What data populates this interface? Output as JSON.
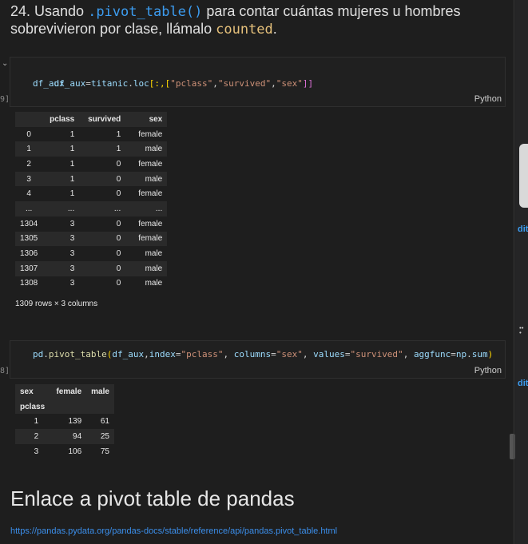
{
  "heading": {
    "part1": "24. Usando ",
    "code1": ".pivot_table()",
    "part2": " para contar cuántas mujeres u hombres sobrevivieron por clase, llámalo ",
    "code2": "counted",
    "part3": "."
  },
  "cell1": {
    "gutter": "9]",
    "line1": [
      "df_aux",
      "=",
      "titanic",
      ".",
      "loc",
      "[:,[",
      "\"pclass\"",
      ",",
      "\"survived\"",
      ",",
      "\"sex\"",
      "]]"
    ],
    "line2": "df_aux",
    "lang": "Python"
  },
  "table1": {
    "columns": [
      "",
      "pclass",
      "survived",
      "sex"
    ],
    "rows": [
      [
        "0",
        "1",
        "1",
        "female"
      ],
      [
        "1",
        "1",
        "1",
        "male"
      ],
      [
        "2",
        "1",
        "0",
        "female"
      ],
      [
        "3",
        "1",
        "0",
        "male"
      ],
      [
        "4",
        "1",
        "0",
        "female"
      ],
      [
        "...",
        "...",
        "...",
        "..."
      ],
      [
        "1304",
        "3",
        "0",
        "female"
      ],
      [
        "1305",
        "3",
        "0",
        "female"
      ],
      [
        "1306",
        "3",
        "0",
        "male"
      ],
      [
        "1307",
        "3",
        "0",
        "male"
      ],
      [
        "1308",
        "3",
        "0",
        "male"
      ]
    ],
    "info": "1309 rows × 3 columns"
  },
  "cell2": {
    "gutter": "8]",
    "tokens": [
      "pd",
      ".",
      "pivot_table",
      "(",
      "df_aux",
      ",",
      "index",
      "=",
      "\"pclass\"",
      ", ",
      "columns",
      "=",
      "\"sex\"",
      ", ",
      "values",
      "=",
      "\"survived\"",
      ", ",
      "aggfunc",
      "=",
      "np",
      ".",
      "sum",
      ")"
    ],
    "lang": "Python"
  },
  "table2": {
    "header1": [
      "sex",
      "female",
      "male"
    ],
    "header2": [
      "pclass",
      "",
      ""
    ],
    "rows": [
      [
        "1",
        "139",
        "61"
      ],
      [
        "2",
        "94",
        "25"
      ],
      [
        "3",
        "106",
        "75"
      ]
    ]
  },
  "section_title": "Enlace a pivot table de pandas",
  "link_text": "https://pandas.pydata.org/pandas-docs/stable/reference/api/pandas.pivot_table.html",
  "right_tags": [
    "dit",
    "dit"
  ],
  "right_dots": "•••"
}
